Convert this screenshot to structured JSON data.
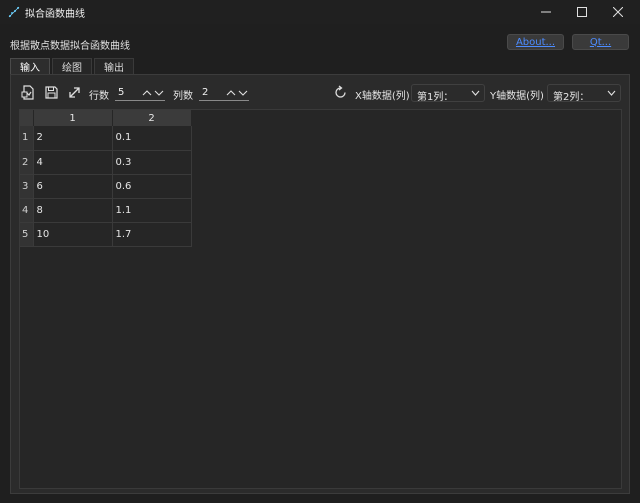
{
  "window": {
    "title": "拟合函数曲线",
    "minimize_icon": "minimize-icon",
    "maximize_icon": "maximize-icon",
    "close_icon": "close-icon"
  },
  "header": {
    "subtitle": "根据散点数据拟合函数曲线",
    "about_label": "About...",
    "qt_label": "Qt..."
  },
  "tabs": [
    {
      "label": "输入",
      "active": true
    },
    {
      "label": "绘图",
      "active": false
    },
    {
      "label": "输出",
      "active": false
    }
  ],
  "toolbar": {
    "icons": [
      "import-file-icon",
      "save-icon",
      "expand-icon",
      "refresh-icon"
    ],
    "rows_label": "行数",
    "rows_value": "5",
    "cols_label": "列数",
    "cols_value": "2",
    "x_label": "X轴数据(列)",
    "x_value": "第1列：",
    "y_label": "Y轴数据(列)",
    "y_value": "第2列："
  },
  "table": {
    "columns": [
      "1",
      "2"
    ],
    "rows": [
      {
        "header": "1",
        "cells": [
          "2",
          "0.1"
        ]
      },
      {
        "header": "2",
        "cells": [
          "4",
          "0.3"
        ]
      },
      {
        "header": "3",
        "cells": [
          "6",
          "0.6"
        ]
      },
      {
        "header": "4",
        "cells": [
          "8",
          "1.1"
        ]
      },
      {
        "header": "5",
        "cells": [
          "10",
          "1.7"
        ]
      }
    ]
  },
  "colors": {
    "background": "#1f1f1f",
    "panel": "#2b2b2b",
    "link": "#4d8cff",
    "header_cell": "#3b3b3b"
  }
}
